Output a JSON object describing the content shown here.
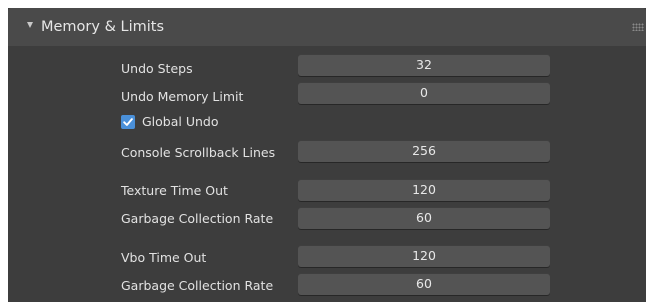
{
  "panel": {
    "title": "Memory & Limits",
    "expanded": true
  },
  "fields": {
    "undo_steps": {
      "label": "Undo Steps",
      "value": "32"
    },
    "undo_memory_limit": {
      "label": "Undo Memory Limit",
      "value": "0"
    },
    "global_undo": {
      "label": "Global Undo",
      "checked": true
    },
    "console_scrollback_lines": {
      "label": "Console Scrollback Lines",
      "value": "256"
    },
    "texture_time_out": {
      "label": "Texture Time Out",
      "value": "120"
    },
    "texture_gc_rate": {
      "label": "Garbage Collection Rate",
      "value": "60"
    },
    "vbo_time_out": {
      "label": "Vbo Time Out",
      "value": "120"
    },
    "vbo_gc_rate": {
      "label": "Garbage Collection Rate",
      "value": "60"
    }
  },
  "colors": {
    "background": "#3d3d3d",
    "header": "#4a4a4a",
    "field": "#545454",
    "checkbox_accent": "#4a90d9",
    "text": "#e2e2e2"
  },
  "icons": {
    "collapse": "triangle-down-icon",
    "drag": "drag-handle-icon",
    "check": "checkmark-icon"
  }
}
